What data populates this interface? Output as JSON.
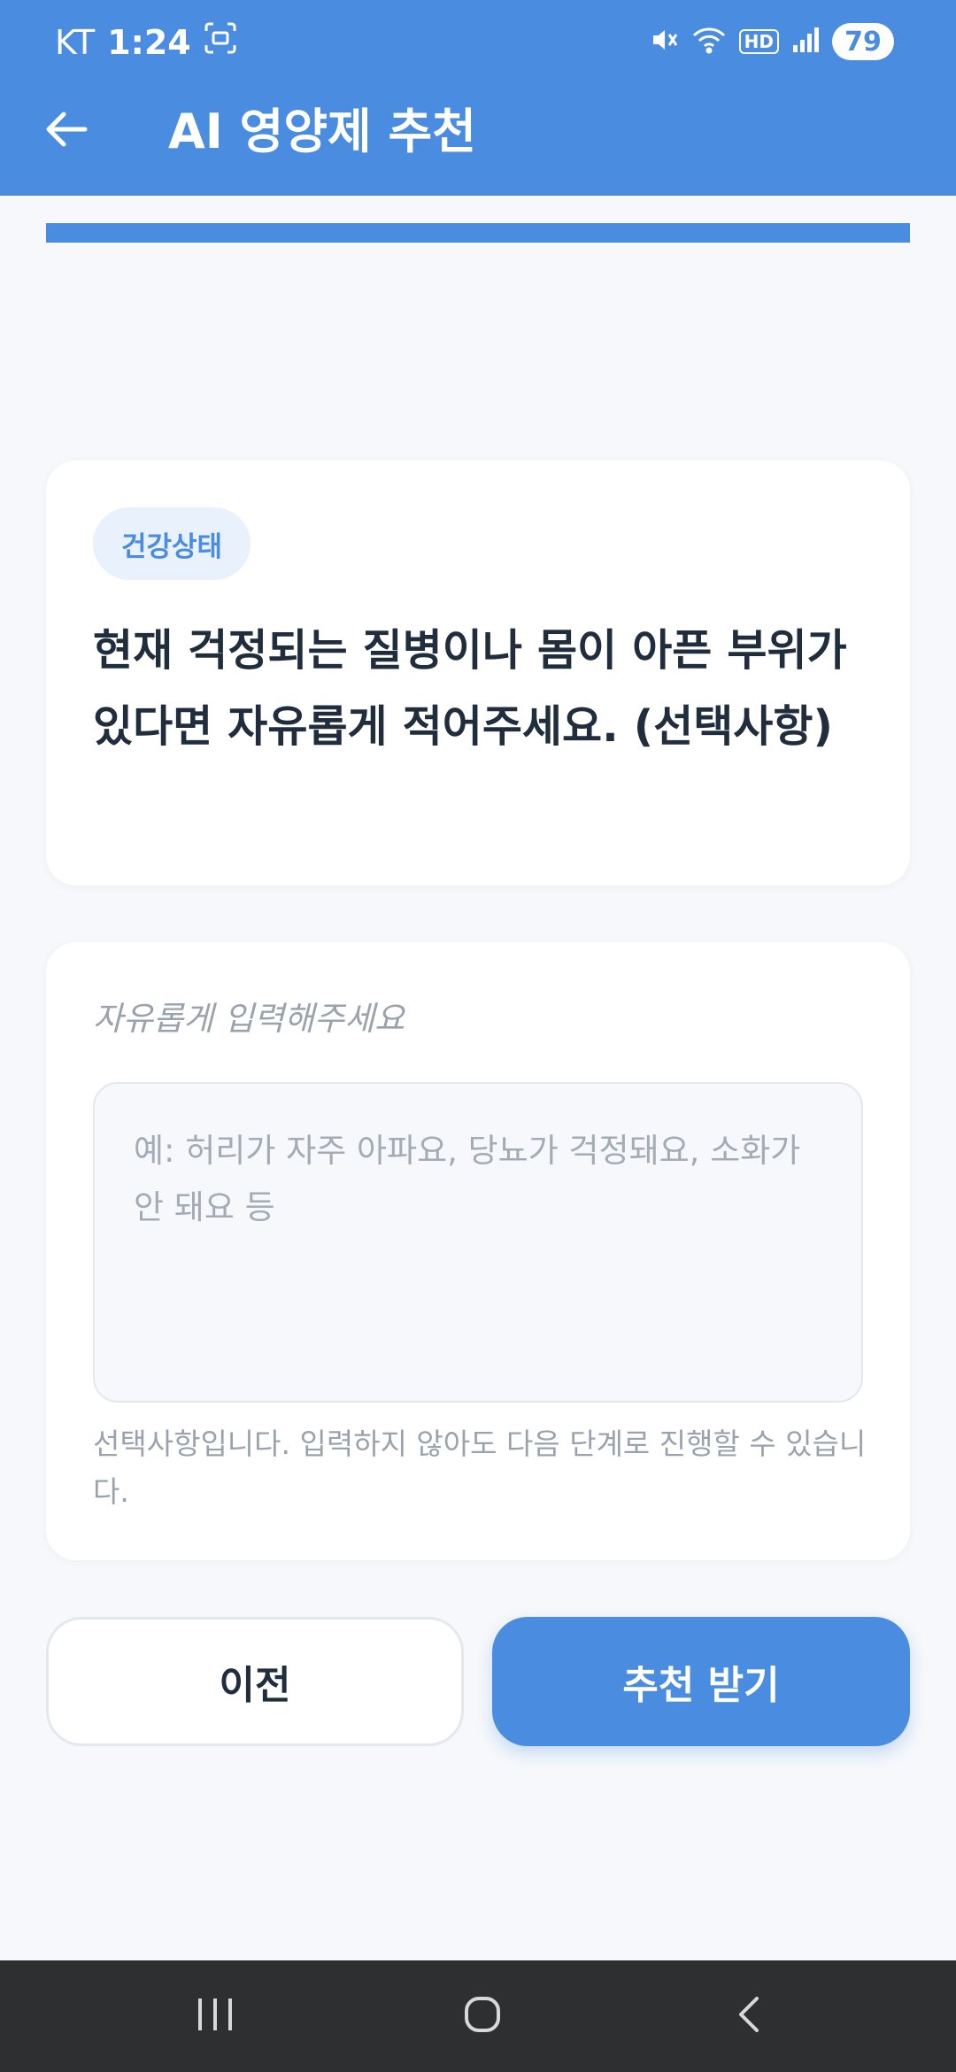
{
  "status_bar": {
    "carrier": "KT",
    "time": "1:24",
    "hd_label": "HD",
    "battery": "79"
  },
  "header": {
    "title": "AI 영양제 추천"
  },
  "progress": {
    "fraction": 1.0
  },
  "question": {
    "category": "건강상태",
    "text": "현재 걱정되는 질병이나 몸이 아픈 부위가 있다면 자유롭게 적어주세요. (선택사항)"
  },
  "answer": {
    "label": "자유롭게 입력해주세요",
    "placeholder": "예: 허리가 자주 아파요, 당뇨가 걱정돼요, 소화가 안 돼요 등",
    "value": "",
    "helper": "선택사항입니다. 입력하지 않아도 다음 단계로 진행할 수 있습니다."
  },
  "buttons": {
    "prev_label": "이전",
    "submit_label": "추천 받기"
  },
  "icons": {
    "back": "arrow-left-icon",
    "recent_apps": "recent-apps-icon",
    "home": "home-icon",
    "nav_back": "chevron-left-icon"
  },
  "colors": {
    "primary": "#4a8cdf",
    "background": "#f6f8fb",
    "text": "#1f2d3d",
    "muted": "#9aa3ad"
  }
}
